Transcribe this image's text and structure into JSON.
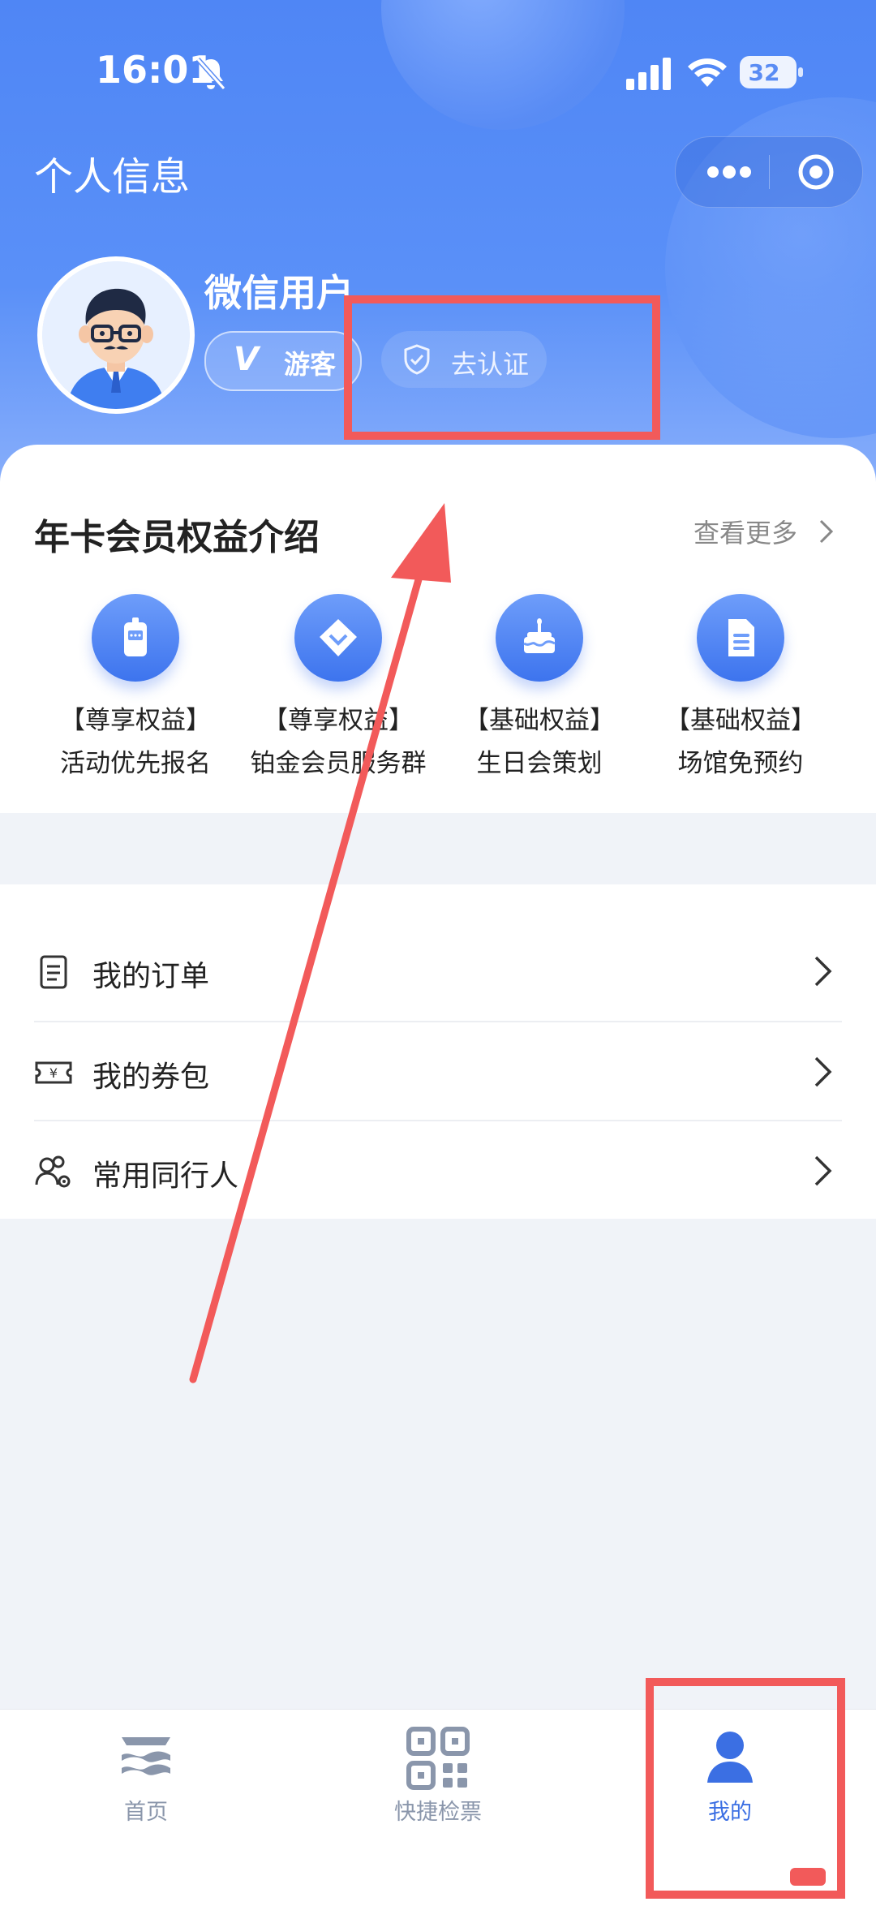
{
  "status_bar": {
    "time": "16:01",
    "battery": "32"
  },
  "header": {
    "title": "个人信息"
  },
  "profile": {
    "username": "微信用户",
    "guest_v": "V",
    "guest_label": "游客",
    "verify_label": "去认证"
  },
  "benefits": {
    "title": "年卡会员权益介绍",
    "more": "查看更多",
    "items": [
      {
        "tag": "【尊享权益】",
        "name": "活动优先报名",
        "icon": "device-icon"
      },
      {
        "tag": "【尊享权益】",
        "name": "铂金会员服务群",
        "icon": "diamond-icon"
      },
      {
        "tag": "【基础权益】",
        "name": "生日会策划",
        "icon": "cake-icon"
      },
      {
        "tag": "【基础权益】",
        "name": "场馆免预约",
        "icon": "document-icon"
      }
    ]
  },
  "menu": {
    "items": [
      {
        "label": "我的订单",
        "icon": "order-list-icon"
      },
      {
        "label": "我的券包",
        "icon": "coupon-icon"
      },
      {
        "label": "常用同行人",
        "icon": "companions-icon"
      }
    ]
  },
  "tabbar": {
    "items": [
      {
        "label": "首页",
        "icon": "home-waves-icon"
      },
      {
        "label": "快捷检票",
        "icon": "qr-code-icon"
      },
      {
        "label": "我的",
        "icon": "person-icon"
      }
    ],
    "active_index": 2
  },
  "colors": {
    "accent": "#3b6fe3",
    "header": "#5a90f8",
    "annotation": "#f25a5a"
  }
}
